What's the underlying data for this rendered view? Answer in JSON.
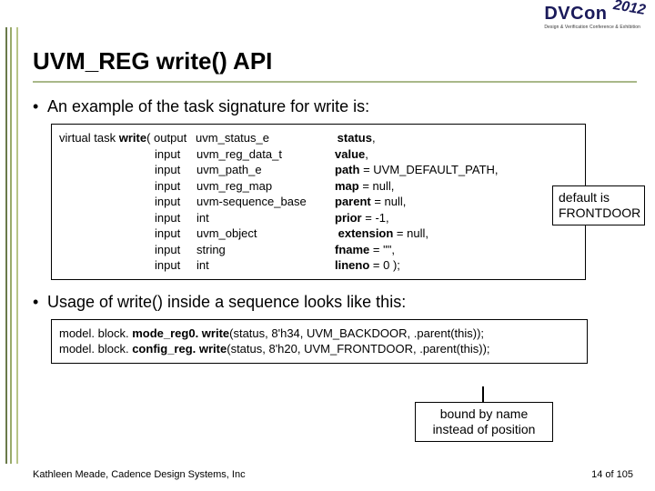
{
  "logo": {
    "brand_dv": "DV",
    "brand_con": "Con",
    "year": "2012",
    "sub": "Design & Verification Conference & Exhibition"
  },
  "title": "UVM_REG write() API",
  "bullets": {
    "b1": "An example of the task signature for write is:",
    "b2": "Usage of write() inside a sequence looks like this:"
  },
  "signature": {
    "lead": "virtual task ",
    "fn": "write",
    "open": "( ",
    "rows": [
      {
        "dir": "output",
        "type": "uvm_status_e",
        "arg_pre": " ",
        "arg_b": "status",
        "arg_post": ","
      },
      {
        "dir": "input",
        "type": "uvm_reg_data_t",
        "arg_pre": "",
        "arg_b": "value",
        "arg_post": ","
      },
      {
        "dir": "input",
        "type": "uvm_path_e",
        "arg_pre": "",
        "arg_b": "path",
        "arg_post": " = UVM_DEFAULT_PATH,"
      },
      {
        "dir": "input",
        "type": "uvm_reg_map",
        "arg_pre": "",
        "arg_b": "map",
        "arg_post": " = null,"
      },
      {
        "dir": "input",
        "type": "uvm-sequence_base",
        "arg_pre": "",
        "arg_b": "parent",
        "arg_post": " = null,"
      },
      {
        "dir": "input",
        "type": "int",
        "arg_pre": "",
        "arg_b": "prior",
        "arg_post": " = -1,"
      },
      {
        "dir": "input",
        "type": "uvm_object",
        "arg_pre": " ",
        "arg_b": "extension",
        "arg_post": " = null,"
      },
      {
        "dir": "input",
        "type": "string",
        "arg_pre": "",
        "arg_b": "fname",
        "arg_post": " = \"\","
      },
      {
        "dir": "input",
        "type": "int",
        "arg_pre": "",
        "arg_b": "lineno",
        "arg_post": " = 0  );"
      }
    ]
  },
  "usage": {
    "l1_a": "model. block. ",
    "l1_b": "mode_reg0. write",
    "l1_c": "(status, 8'h34, UVM_BACKDOOR, .parent(this));",
    "l2_a": "model. block. ",
    "l2_b": "config_reg. write",
    "l2_c": "(status, 8'h20, UVM_FRONTDOOR, .parent(this));"
  },
  "callouts": {
    "c1a": "default is",
    "c1b": "FRONTDOOR",
    "c2a": "bound by name",
    "c2b": "instead of position"
  },
  "footer": {
    "author": "Kathleen Meade, Cadence Design Systems, Inc",
    "page": "14 of 105"
  }
}
